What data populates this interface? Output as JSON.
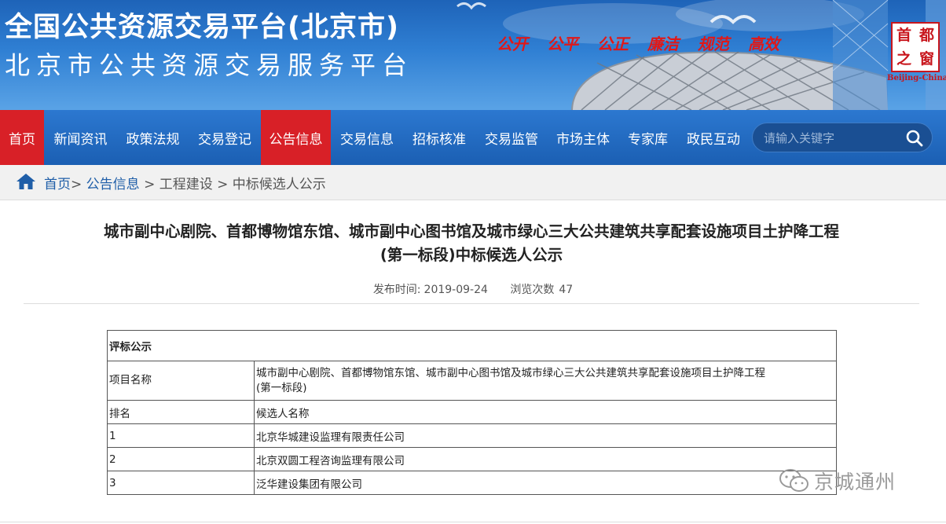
{
  "banner": {
    "title": "全国公共资源交易平台(北京市)",
    "subtitle": "北京市公共资源交易服务平台",
    "slogans": [
      "公开",
      "公平",
      "公正",
      "廉洁",
      "规范",
      "高效"
    ],
    "seal_chars": [
      "首",
      "都",
      "之",
      "窗"
    ],
    "seal_caption": "Beijing-China"
  },
  "nav": {
    "items": [
      "首页",
      "新闻资讯",
      "政策法规",
      "交易登记",
      "公告信息",
      "交易信息",
      "招标核准",
      "交易监管",
      "市场主体",
      "专家库",
      "政民互动"
    ],
    "search_placeholder": "请输入关键字"
  },
  "breadcrumb": {
    "home": "首页",
    "sep1": ">",
    "notice": "公告信息",
    "sep2": ">",
    "category": "工程建设",
    "sep3": ">",
    "current": "中标候选人公示"
  },
  "article": {
    "title_line1": "城市副中心剧院、首都博物馆东馆、城市副中心图书馆及城市绿心三大公共建筑共享配套设施项目土护降工程",
    "title_line2": "(第一标段)中标候选人公示",
    "publish_label": "发布时间:",
    "publish_date": "2019-09-24",
    "views_label": "浏览次数",
    "views": "47"
  },
  "table": {
    "header": "评标公示",
    "project_label": "项目名称",
    "project_name_line1": "城市副中心剧院、首都博物馆东馆、城市副中心图书馆及城市绿心三大公共建筑共享配套设施项目土护降工程",
    "project_name_line2": "(第一标段)",
    "rank_label": "排名",
    "candidate_label": "候选人名称",
    "rows": [
      {
        "rank": "1",
        "name": "北京华城建设监理有限责任公司"
      },
      {
        "rank": "2",
        "name": "北京双圆工程咨询监理有限公司"
      },
      {
        "rank": "3",
        "name": "泛华建设集团有限公司"
      }
    ]
  },
  "watermark": {
    "text": "京城通州"
  },
  "colors": {
    "nav_blue": "#1b5fb3",
    "active_red": "#d82027",
    "link_blue": "#1f5ea8",
    "slogan_red": "#e01818"
  }
}
